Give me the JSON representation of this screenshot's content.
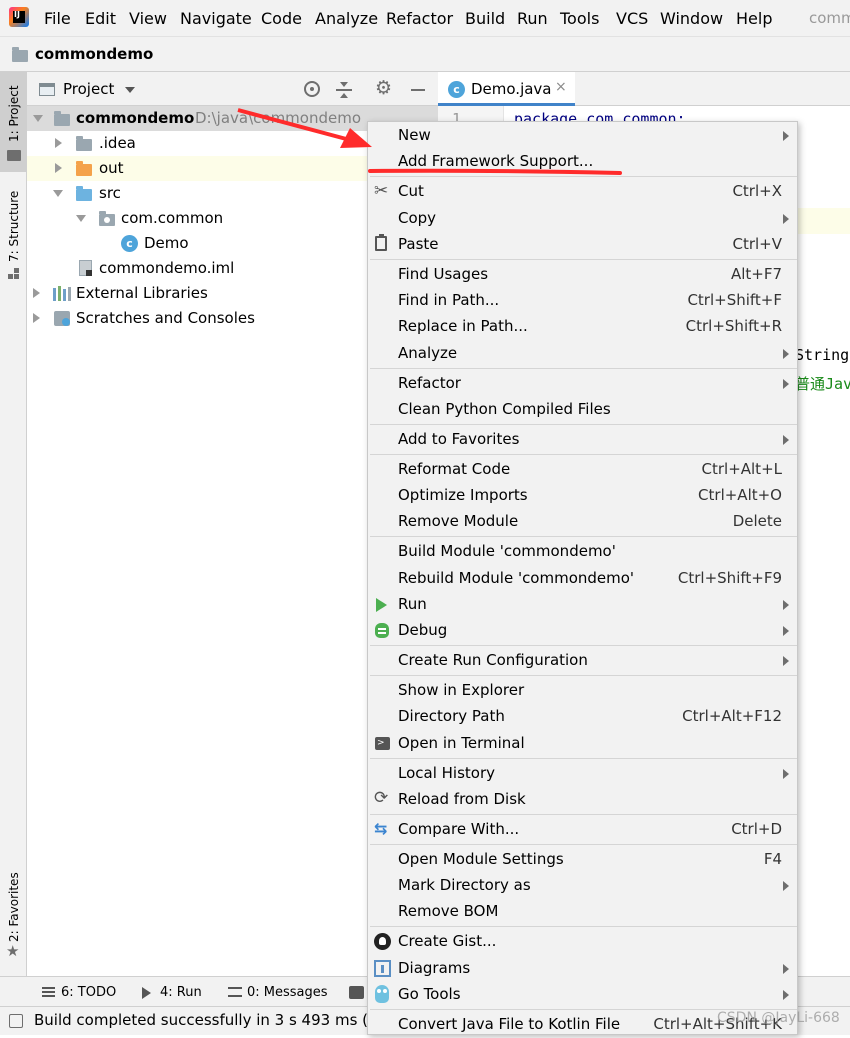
{
  "menubar": {
    "items": [
      "File",
      "Edit",
      "View",
      "Navigate",
      "Code",
      "Analyze",
      "Refactor",
      "Build",
      "Run",
      "Tools",
      "VCS",
      "Window",
      "Help"
    ],
    "faded_title": "comm"
  },
  "navbar": {
    "project": "commondemo"
  },
  "left_stripe": {
    "project_tab": "1: Project",
    "structure_tab": "7: Structure",
    "favorites_tab": "2: Favorites"
  },
  "project_panel": {
    "title": "Project",
    "tree": [
      {
        "label": "commondemo",
        "path": "D:\\java\\commondemo"
      },
      {
        "label": ".idea"
      },
      {
        "label": "out"
      },
      {
        "label": "src"
      },
      {
        "label": "com.common"
      },
      {
        "label": "Demo"
      },
      {
        "label": "commondemo.iml"
      },
      {
        "label": "External Libraries"
      },
      {
        "label": "Scratches and Consoles"
      }
    ]
  },
  "editor": {
    "tab_label": "Demo.java",
    "line_number": "1",
    "code_line1": "package com.common;",
    "code_fragment1": "String",
    "code_fragment2": "普通Jav"
  },
  "context_menu": {
    "items": [
      {
        "label": "New",
        "shortcut": "",
        "submenu": true
      },
      {
        "label": "Add Framework Support...",
        "shortcut": "",
        "submenu": false
      },
      {
        "label": "Cut",
        "shortcut": "Ctrl+X",
        "submenu": false,
        "icon": "scissors-icon"
      },
      {
        "label": "Copy",
        "shortcut": "",
        "submenu": true
      },
      {
        "label": "Paste",
        "shortcut": "Ctrl+V",
        "submenu": false,
        "icon": "clipboard-icon"
      },
      {
        "label": "Find Usages",
        "shortcut": "Alt+F7",
        "submenu": false
      },
      {
        "label": "Find in Path...",
        "shortcut": "Ctrl+Shift+F",
        "submenu": false
      },
      {
        "label": "Replace in Path...",
        "shortcut": "Ctrl+Shift+R",
        "submenu": false
      },
      {
        "label": "Analyze",
        "shortcut": "",
        "submenu": true
      },
      {
        "label": "Refactor",
        "shortcut": "",
        "submenu": true
      },
      {
        "label": "Clean Python Compiled Files",
        "shortcut": "",
        "submenu": false
      },
      {
        "label": "Add to Favorites",
        "shortcut": "",
        "submenu": true
      },
      {
        "label": "Reformat Code",
        "shortcut": "Ctrl+Alt+L",
        "submenu": false
      },
      {
        "label": "Optimize Imports",
        "shortcut": "Ctrl+Alt+O",
        "submenu": false
      },
      {
        "label": "Remove Module",
        "shortcut": "Delete",
        "submenu": false
      },
      {
        "label": "Build Module 'commondemo'",
        "shortcut": "",
        "submenu": false
      },
      {
        "label": "Rebuild Module 'commondemo'",
        "shortcut": "Ctrl+Shift+F9",
        "submenu": false
      },
      {
        "label": "Run",
        "shortcut": "",
        "submenu": true,
        "icon": "run-icon"
      },
      {
        "label": "Debug",
        "shortcut": "",
        "submenu": true,
        "icon": "debug-icon"
      },
      {
        "label": "Create Run Configuration",
        "shortcut": "",
        "submenu": true
      },
      {
        "label": "Show in Explorer",
        "shortcut": "",
        "submenu": false
      },
      {
        "label": "Directory Path",
        "shortcut": "Ctrl+Alt+F12",
        "submenu": false
      },
      {
        "label": "Open in Terminal",
        "shortcut": "",
        "submenu": false,
        "icon": "terminal-icon"
      },
      {
        "label": "Local History",
        "shortcut": "",
        "submenu": true
      },
      {
        "label": "Reload from Disk",
        "shortcut": "",
        "submenu": false,
        "icon": "reload-icon"
      },
      {
        "label": "Compare With...",
        "shortcut": "Ctrl+D",
        "submenu": false,
        "icon": "compare-icon"
      },
      {
        "label": "Open Module Settings",
        "shortcut": "F4",
        "submenu": false
      },
      {
        "label": "Mark Directory as",
        "shortcut": "",
        "submenu": true
      },
      {
        "label": "Remove BOM",
        "shortcut": "",
        "submenu": false
      },
      {
        "label": "Create Gist...",
        "shortcut": "",
        "submenu": false,
        "icon": "github-icon"
      },
      {
        "label": "Diagrams",
        "shortcut": "",
        "submenu": true,
        "icon": "diagram-icon"
      },
      {
        "label": "Go Tools",
        "shortcut": "",
        "submenu": true,
        "icon": "gopher-icon"
      },
      {
        "label": "Convert Java File to Kotlin File",
        "shortcut": "Ctrl+Alt+Shift+K",
        "submenu": false
      }
    ]
  },
  "bottom_tabs": {
    "todo": "6: TODO",
    "run": "4: Run",
    "messages": "0: Messages"
  },
  "status": {
    "text": "Build completed successfully in 3 s 493 ms (3 r"
  },
  "watermark": "CSDN @JayLi-668",
  "colors": {
    "accent": "#4083c9",
    "annotation": "#ff2b2b",
    "run_green": "#4caf50",
    "selection": "#fdfde8"
  }
}
